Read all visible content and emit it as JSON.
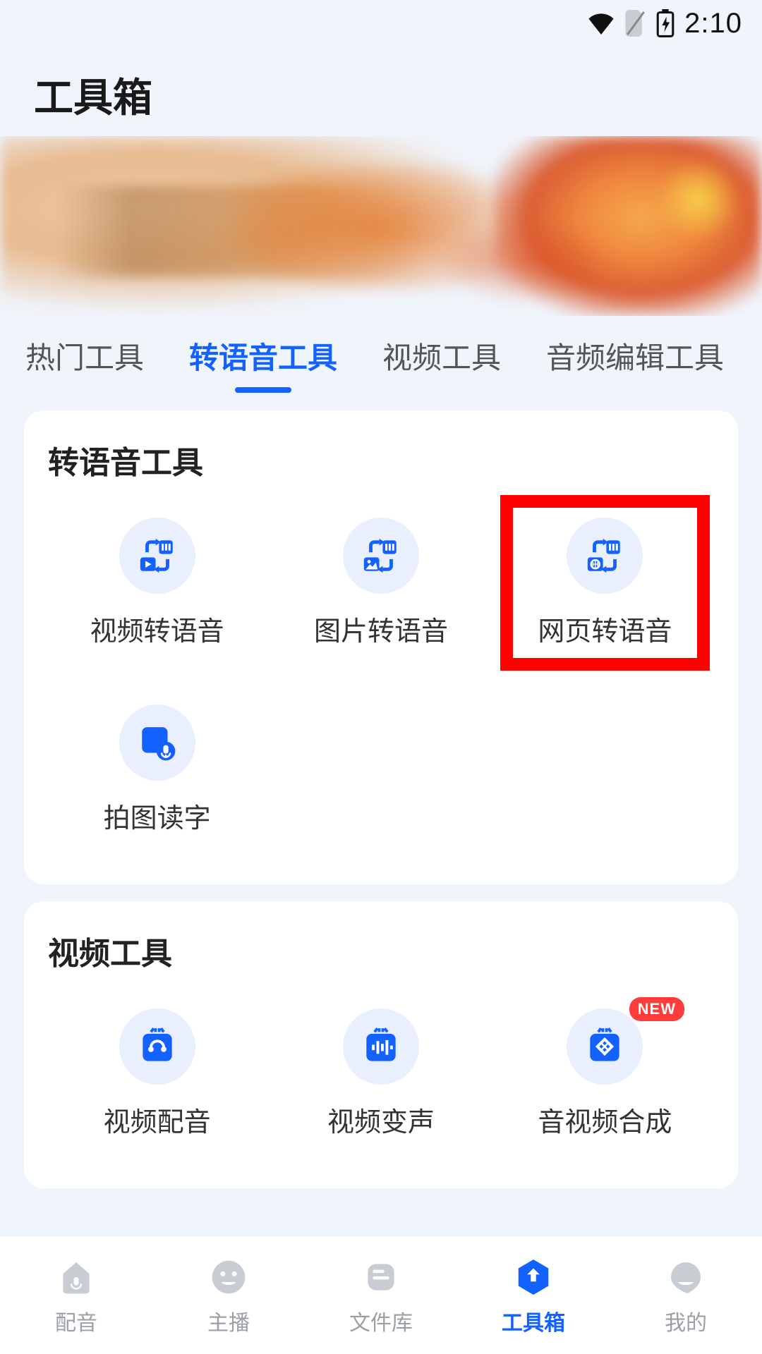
{
  "status": {
    "time": "2:10"
  },
  "header": {
    "title": "工具箱"
  },
  "tabs": [
    {
      "label": "热门工具",
      "active": false
    },
    {
      "label": "转语音工具",
      "active": true
    },
    {
      "label": "视频工具",
      "active": false
    },
    {
      "label": "音频编辑工具",
      "active": false
    }
  ],
  "sections": {
    "tts": {
      "title": "转语音工具",
      "items": [
        {
          "label": "视频转语音"
        },
        {
          "label": "图片转语音"
        },
        {
          "label": "网页转语音"
        },
        {
          "label": "拍图读字"
        }
      ]
    },
    "video": {
      "title": "视频工具",
      "items": [
        {
          "label": "视频配音"
        },
        {
          "label": "视频变声"
        },
        {
          "label": "音视频合成",
          "badge": "NEW"
        }
      ]
    }
  },
  "bottomNav": [
    {
      "label": "配音"
    },
    {
      "label": "主播"
    },
    {
      "label": "文件库"
    },
    {
      "label": "工具箱",
      "active": true
    },
    {
      "label": "我的"
    }
  ]
}
